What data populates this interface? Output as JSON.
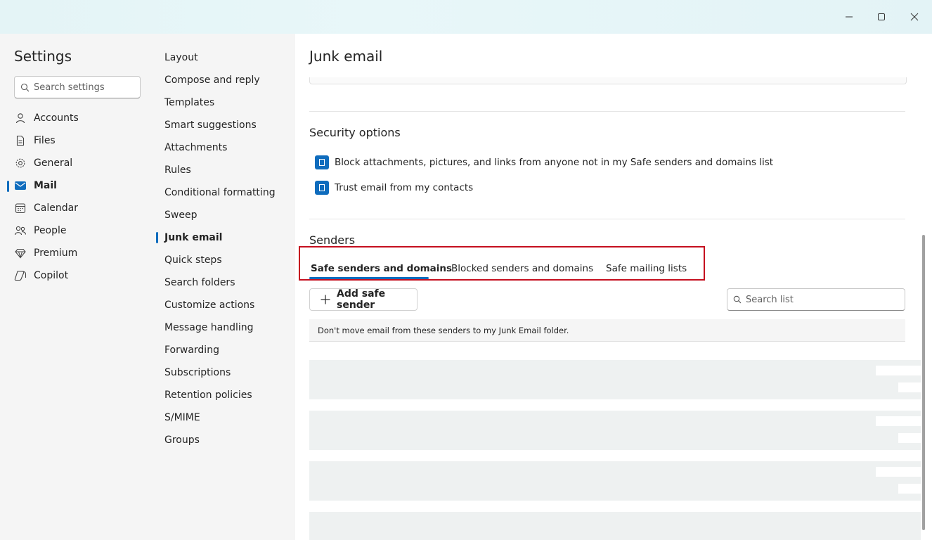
{
  "window": {
    "controls": [
      "minimize-icon",
      "maximize-icon",
      "close-icon"
    ]
  },
  "sidebar": {
    "title": "Settings",
    "search_placeholder": "Search settings",
    "items": [
      {
        "label": "Accounts",
        "icon": "person-icon"
      },
      {
        "label": "Files",
        "icon": "file-icon"
      },
      {
        "label": "General",
        "icon": "gear-icon"
      },
      {
        "label": "Mail",
        "icon": "mail-icon",
        "active": true
      },
      {
        "label": "Calendar",
        "icon": "calendar-icon"
      },
      {
        "label": "People",
        "icon": "people-icon"
      },
      {
        "label": "Premium",
        "icon": "diamond-icon"
      },
      {
        "label": "Copilot",
        "icon": "copilot-icon"
      }
    ]
  },
  "submenu": {
    "items": [
      {
        "label": "Layout"
      },
      {
        "label": "Compose and reply"
      },
      {
        "label": "Templates"
      },
      {
        "label": "Smart suggestions"
      },
      {
        "label": "Attachments"
      },
      {
        "label": "Rules"
      },
      {
        "label": "Conditional formatting"
      },
      {
        "label": "Sweep"
      },
      {
        "label": "Junk email",
        "active": true
      },
      {
        "label": "Quick steps"
      },
      {
        "label": "Search folders"
      },
      {
        "label": "Customize actions"
      },
      {
        "label": "Message handling"
      },
      {
        "label": "Forwarding"
      },
      {
        "label": "Subscriptions"
      },
      {
        "label": "Retention policies"
      },
      {
        "label": "S/MIME"
      },
      {
        "label": "Groups"
      }
    ]
  },
  "main": {
    "title": "Junk email",
    "security": {
      "title": "Security options",
      "options": [
        {
          "label": "Block attachments, pictures, and links from anyone not in my Safe senders and domains list",
          "checked": true
        },
        {
          "label": "Trust email from my contacts",
          "checked": true
        }
      ]
    },
    "senders": {
      "title": "Senders",
      "tabs": [
        {
          "label": "Safe senders and domains",
          "active": true
        },
        {
          "label": "Blocked senders and domains"
        },
        {
          "label": "Safe mailing lists"
        }
      ],
      "add_button": "Add safe sender",
      "search_placeholder": "Search list",
      "info": "Don't move email from these senders to my Junk Email folder."
    }
  },
  "colors": {
    "accent": "#0f6cbd",
    "highlight": "#c50f1f"
  }
}
